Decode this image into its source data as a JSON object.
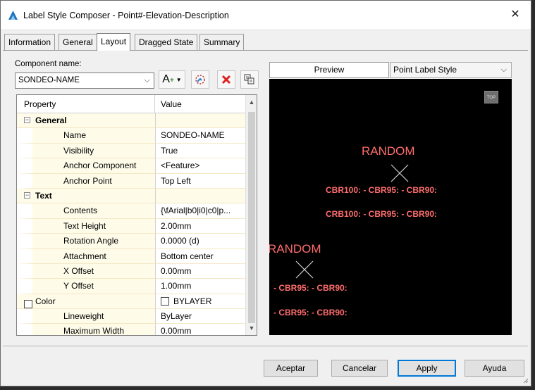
{
  "window": {
    "title": "Label Style Composer - Point#-Elevation-Description",
    "close_glyph": "✕"
  },
  "tabs": [
    {
      "label": "Information",
      "active": false
    },
    {
      "label": "General",
      "active": false
    },
    {
      "label": "Layout",
      "active": true
    },
    {
      "label": "Dragged State",
      "active": false
    },
    {
      "label": "Summary",
      "active": false
    }
  ],
  "component": {
    "label": "Component name:",
    "value": "SONDEO-NAME"
  },
  "toolbar": {
    "add_text_glyph": "A",
    "add_plus_glyph": "+",
    "icons": [
      "add-component-icon",
      "copy-component-icon",
      "delete-component-icon",
      "draw-order-icon"
    ]
  },
  "grid": {
    "col_property": "Property",
    "col_value": "Value",
    "rows": [
      {
        "type": "cat",
        "prop": "General",
        "val": "",
        "toggle": "⊟"
      },
      {
        "type": "prop",
        "prop": "Name",
        "val": "SONDEO-NAME"
      },
      {
        "type": "prop",
        "prop": "Visibility",
        "val": "True"
      },
      {
        "type": "prop",
        "prop": "Anchor Component",
        "val": "<Feature>"
      },
      {
        "type": "prop",
        "prop": "Anchor Point",
        "val": "Top Left"
      },
      {
        "type": "cat",
        "prop": "Text",
        "val": "",
        "toggle": "⊟"
      },
      {
        "type": "prop",
        "prop": "Contents",
        "val": "{\\fArial|b0|i0|c0|p..."
      },
      {
        "type": "prop",
        "prop": "Text Height",
        "val": "2.00mm"
      },
      {
        "type": "prop",
        "prop": "Rotation Angle",
        "val": "0.0000 (d)"
      },
      {
        "type": "prop",
        "prop": "Attachment",
        "val": "Bottom center"
      },
      {
        "type": "prop",
        "prop": "X Offset",
        "val": "0.00mm"
      },
      {
        "type": "prop",
        "prop": "Y Offset",
        "val": "1.00mm"
      },
      {
        "type": "color",
        "prop": "Color",
        "val": "BYLAYER"
      },
      {
        "type": "prop",
        "prop": "Lineweight",
        "val": "ByLayer"
      },
      {
        "type": "prop",
        "prop": "Maximum Width",
        "val": "0.00mm"
      }
    ]
  },
  "preview": {
    "tab_label": "Preview",
    "style_select": "Point Label Style",
    "view_badge": "TOP",
    "label_color": "#ff6d6d",
    "label1": {
      "name": "RANDOM",
      "line1": "CBR100: - CBR95: - CBR90:",
      "line2": "CRB100: - CBR95: - CBR90:"
    },
    "label2": {
      "name": "RANDOM",
      "line1": "- CBR95: - CBR90:",
      "line2": "- CBR95: - CBR90:"
    }
  },
  "buttons": {
    "ok": "Aceptar",
    "cancel": "Cancelar",
    "apply": "Apply",
    "help": "Ayuda"
  }
}
